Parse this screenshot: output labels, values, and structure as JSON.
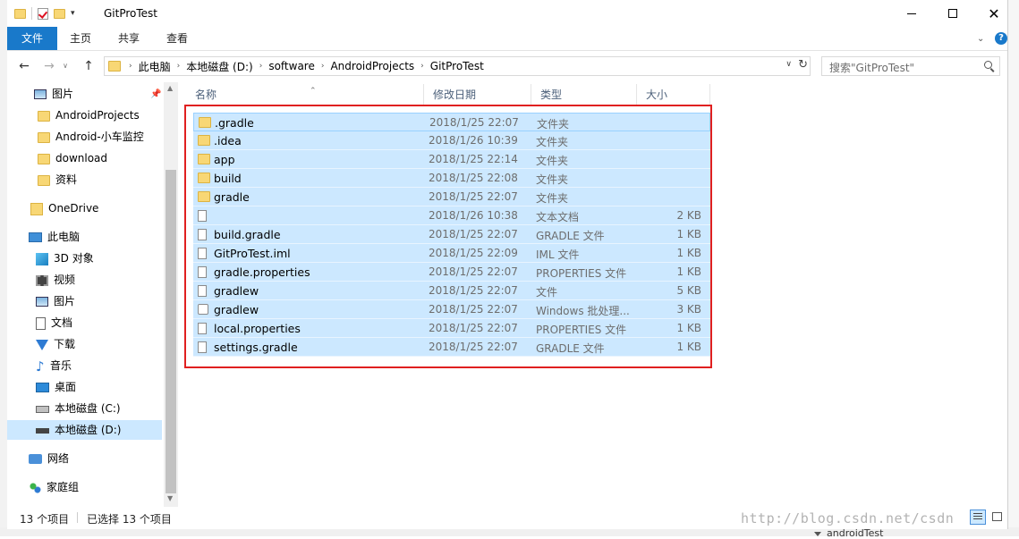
{
  "window": {
    "title": "GitProTest",
    "qat_dropdown": "▾"
  },
  "ribbon": {
    "tabs": [
      "文件",
      "主页",
      "共享",
      "查看"
    ],
    "expand": "⌄",
    "help": "?"
  },
  "address": {
    "breadcrumbs": [
      "此电脑",
      "本地磁盘 (D:)",
      "software",
      "AndroidProjects",
      "GitProTest"
    ],
    "search_placeholder": "搜索\"GitProTest\""
  },
  "nav": {
    "items": [
      {
        "label": "图片",
        "icon": "picture-icon"
      },
      {
        "label": "AndroidProjects",
        "icon": "folder-icon"
      },
      {
        "label": "Android-小车监控",
        "icon": "folder-icon"
      },
      {
        "label": "download",
        "icon": "folder-icon"
      },
      {
        "label": "资料",
        "icon": "folder-icon"
      },
      {
        "label": "OneDrive",
        "icon": "onedrive-icon"
      },
      {
        "label": "此电脑",
        "icon": "this-pc-icon"
      },
      {
        "label": "3D 对象",
        "icon": "3d-objects-icon"
      },
      {
        "label": "视频",
        "icon": "video-icon"
      },
      {
        "label": "图片",
        "icon": "picture-icon"
      },
      {
        "label": "文档",
        "icon": "document-icon"
      },
      {
        "label": "下载",
        "icon": "download-icon"
      },
      {
        "label": "音乐",
        "icon": "music-icon"
      },
      {
        "label": "桌面",
        "icon": "desktop-icon"
      },
      {
        "label": "本地磁盘 (C:)",
        "icon": "drive-c-icon"
      },
      {
        "label": "本地磁盘 (D:)",
        "icon": "drive-d-icon",
        "selected": true
      },
      {
        "label": "网络",
        "icon": "network-icon"
      },
      {
        "label": "家庭组",
        "icon": "homegroup-icon"
      }
    ]
  },
  "columns": {
    "name": "名称",
    "date": "修改日期",
    "type": "类型",
    "size": "大小"
  },
  "files": [
    {
      "name": ".gradle",
      "date": "2018/1/25 22:07",
      "type": "文件夹",
      "size": "",
      "icon": "folder-icon"
    },
    {
      "name": ".idea",
      "date": "2018/1/26 10:39",
      "type": "文件夹",
      "size": "",
      "icon": "folder-icon"
    },
    {
      "name": "app",
      "date": "2018/1/25 22:14",
      "type": "文件夹",
      "size": "",
      "icon": "folder-icon"
    },
    {
      "name": "build",
      "date": "2018/1/25 22:08",
      "type": "文件夹",
      "size": "",
      "icon": "folder-icon"
    },
    {
      "name": "gradle",
      "date": "2018/1/25 22:07",
      "type": "文件夹",
      "size": "",
      "icon": "folder-icon"
    },
    {
      "name": "",
      "date": "2018/1/26 10:38",
      "type": "文本文档",
      "size": "2 KB",
      "icon": "text-file-icon"
    },
    {
      "name": "build.gradle",
      "date": "2018/1/25 22:07",
      "type": "GRADLE 文件",
      "size": "1 KB",
      "icon": "file-icon"
    },
    {
      "name": "GitProTest.iml",
      "date": "2018/1/25 22:09",
      "type": "IML 文件",
      "size": "1 KB",
      "icon": "file-icon"
    },
    {
      "name": "gradle.properties",
      "date": "2018/1/25 22:07",
      "type": "PROPERTIES 文件",
      "size": "1 KB",
      "icon": "file-icon"
    },
    {
      "name": "gradlew",
      "date": "2018/1/25 22:07",
      "type": "文件",
      "size": "5 KB",
      "icon": "file-icon"
    },
    {
      "name": "gradlew",
      "date": "2018/1/25 22:07",
      "type": "Windows 批处理...",
      "size": "3 KB",
      "icon": "batch-file-icon"
    },
    {
      "name": "local.properties",
      "date": "2018/1/25 22:07",
      "type": "PROPERTIES 文件",
      "size": "1 KB",
      "icon": "file-icon"
    },
    {
      "name": "settings.gradle",
      "date": "2018/1/25 22:07",
      "type": "GRADLE 文件",
      "size": "1 KB",
      "icon": "file-icon"
    }
  ],
  "status": {
    "count": "13 个项目",
    "selected": "已选择 13 个项目"
  },
  "watermark": "http://blog.csdn.net/csdn",
  "background": {
    "bottom_item": "androidTest"
  },
  "colors": {
    "accent": "#1979ca",
    "selection": "#cce8ff",
    "highlight_border": "#e02020",
    "folder": "#f8d775"
  }
}
